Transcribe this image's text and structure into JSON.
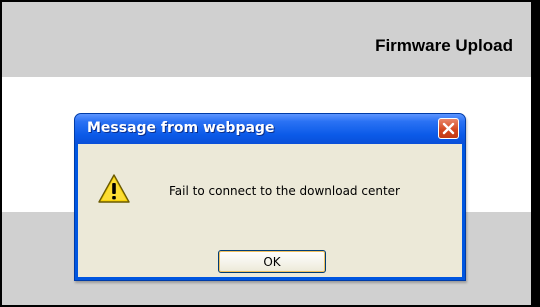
{
  "page": {
    "header_title": "Firmware Upload"
  },
  "dialog": {
    "title": "Message from webpage",
    "message": "Fail to connect to the download center",
    "ok_label": "OK",
    "icon": "warning-icon",
    "close_icon": "close-icon"
  },
  "colors": {
    "titlebar": "#0b5ae8",
    "client_bg": "#ece9d8",
    "page_band": "#d0d0d0",
    "close_button": "#d2451d",
    "warning_yellow": "#f7d20a"
  }
}
